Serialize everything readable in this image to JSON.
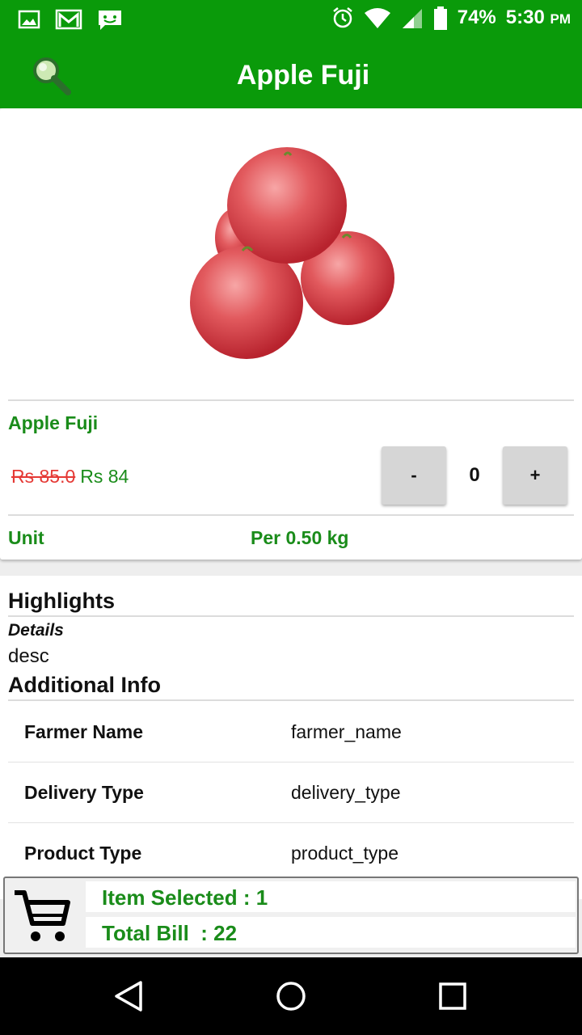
{
  "status_bar": {
    "battery": "74%",
    "time": "5:30",
    "ampm": "PM",
    "icons": [
      "image-icon",
      "gmail-icon",
      "sms-icon",
      "alarm-icon",
      "wifi-icon",
      "signal-icon",
      "battery-icon"
    ]
  },
  "app_bar": {
    "title": "Apple Fuji",
    "search_icon": "search-icon"
  },
  "product": {
    "name": "Apple Fuji",
    "old_price": "Rs 85.0",
    "new_price": "Rs 84",
    "quantity": {
      "minus_label": "-",
      "value": "0",
      "plus_label": "+"
    },
    "unit_label": "Unit",
    "unit_value": "Per 0.50 kg"
  },
  "details": {
    "highlights_title": "Highlights",
    "details_label": "Details",
    "description": "desc",
    "additional_title": "Additional Info",
    "rows": [
      {
        "key": "Farmer Name",
        "value": "farmer_name"
      },
      {
        "key": "Delivery Type",
        "value": "delivery_type"
      },
      {
        "key": "Product Type",
        "value": "product_type"
      }
    ]
  },
  "cart": {
    "icon": "cart-icon",
    "items_selected": "Item Selected : 1",
    "total_bill": "Total Bill  : 22"
  },
  "nav_bar": {
    "buttons": [
      "back-icon",
      "home-icon",
      "recents-icon"
    ]
  },
  "colors": {
    "primary_green": "#0a9a0a",
    "text_green": "#1a8c1a",
    "strike_red": "#e53935"
  }
}
